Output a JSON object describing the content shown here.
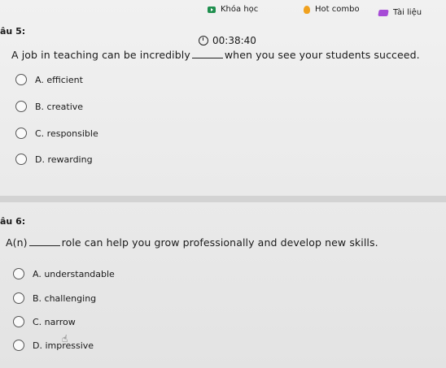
{
  "nav": {
    "courses": "Khóa học",
    "hot_combo": "Hot combo",
    "materials": "Tài liệu"
  },
  "timer": "00:38:40",
  "q5": {
    "label": "âu 5:",
    "text_before": "A job in teaching can be incredibly",
    "text_after": "when you see your students succeed.",
    "options": [
      "A. efficient",
      "B. creative",
      "C. responsible",
      "D. rewarding"
    ]
  },
  "q6": {
    "label": "âu 6:",
    "text_before": "A(n)",
    "text_after": "role can help you grow professionally and develop new skills.",
    "options": [
      "A. understandable",
      "B. challenging",
      "C. narrow",
      "D. impressive"
    ]
  },
  "colors": {
    "play_icon": "#1f8f4e",
    "fire_icon": "#f0a11e",
    "book_icon": "#a64bd6"
  }
}
